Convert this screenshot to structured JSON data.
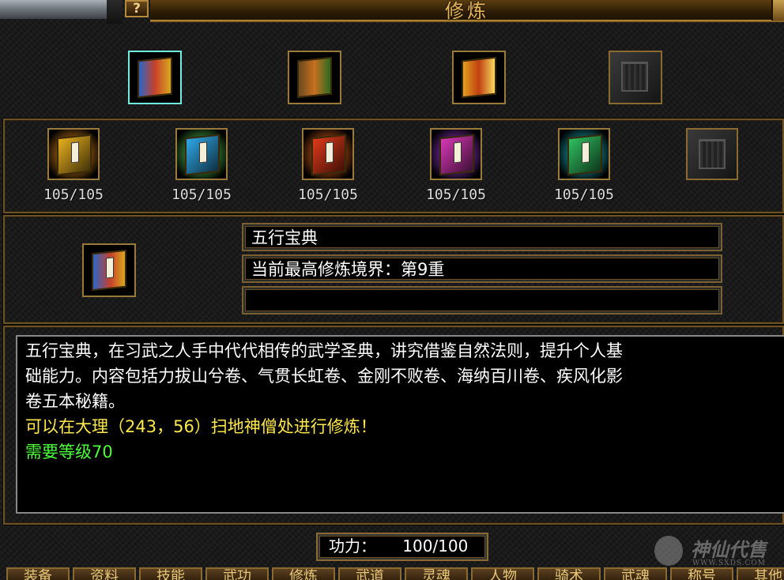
{
  "window": {
    "title": "修炼",
    "help_label": "?"
  },
  "books_row1": [
    {
      "name": "wuxing-baodian-slot",
      "colors": [
        "#2b66c8",
        "#c8402a",
        "#d8a820"
      ],
      "selected": true
    },
    {
      "name": "scrolls-slot",
      "colors": [
        "#6a4a20",
        "#c87020",
        "#2a6a20"
      ],
      "selected": false
    },
    {
      "name": "gold-treasure-slot",
      "colors": [
        "#e0a020",
        "#c04010",
        "#f8d860"
      ],
      "selected": false
    },
    {
      "name": "empty-slot",
      "empty": true
    }
  ],
  "books_row2": [
    {
      "color": "#e8b020",
      "glow": "#ff9a20",
      "count": "105/105"
    },
    {
      "color": "#30a8e8",
      "glow": "#60e060",
      "count": "105/105"
    },
    {
      "color": "#e03a1a",
      "glow": "#ff7020",
      "count": "105/105"
    },
    {
      "color": "#d838b8",
      "glow": "#b040f0",
      "count": "105/105"
    },
    {
      "color": "#30c060",
      "glow": "#20d0e0",
      "count": "105/105"
    },
    {
      "empty": true
    }
  ],
  "detail": {
    "name": "五行宝典",
    "realm": "当前最高修炼境界：第9重",
    "extra": ""
  },
  "description": {
    "lines": [
      "五行宝典，在习武之人手中代代相传的武学圣典，讲究借鉴自然法则，提升个人基",
      "础能力。内容包括力拔山兮卷、气贯长虹卷、金刚不败卷、海纳百川卷、疾风化影",
      "卷五本秘籍。"
    ],
    "location": "可以在大理（243，56）扫地神僧处进行修炼！",
    "requirement": "需要等级70"
  },
  "power": {
    "label": "功力：",
    "value": "100/100"
  },
  "bottom_tabs": [
    "装备",
    "资料",
    "技能",
    "武功",
    "修炼",
    "武道",
    "灵魂",
    "人物",
    "骑术",
    "武魂",
    "称号",
    "其他"
  ],
  "watermark": {
    "text": "神仙代售",
    "url": "WWW.SXDS.COM"
  }
}
